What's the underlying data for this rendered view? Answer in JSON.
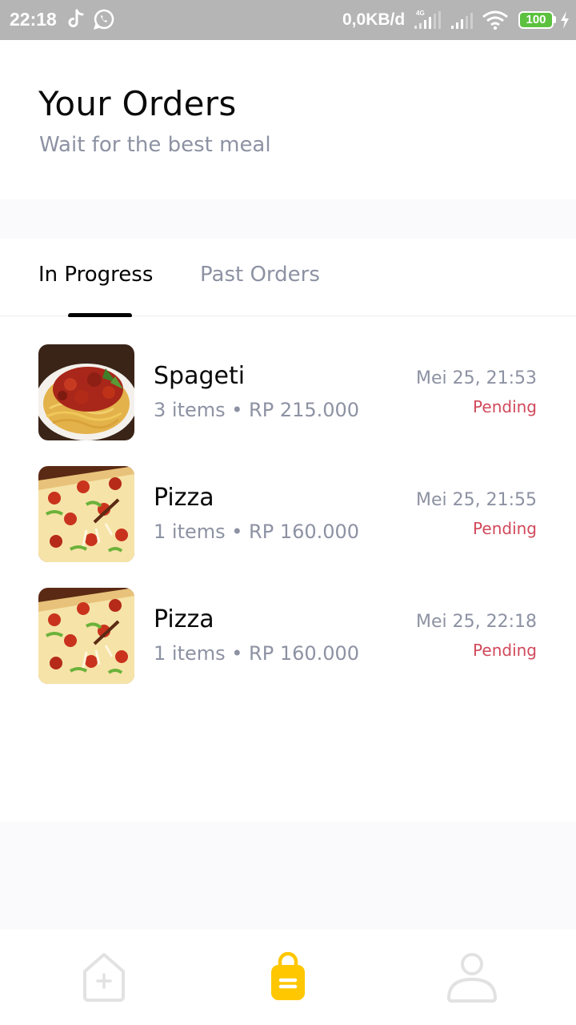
{
  "status_bar": {
    "time": "22:18",
    "network_speed": "0,0KB/d",
    "network_type": "4G",
    "battery": "100",
    "icons": [
      "tiktok-icon",
      "whatsapp-icon",
      "signal-icon",
      "wifi-icon",
      "battery-icon",
      "charging-icon"
    ]
  },
  "header": {
    "title": "Your Orders",
    "subtitle": "Wait for the best meal"
  },
  "tabs": [
    {
      "label": "In Progress",
      "active": true
    },
    {
      "label": "Past Orders",
      "active": false
    }
  ],
  "orders": [
    {
      "name": "Spageti",
      "quantity": "3 items",
      "price": "RP 215.000",
      "date": "Mei 25, 21:53",
      "status": "Pending",
      "image": "spaghetti-image"
    },
    {
      "name": "Pizza",
      "quantity": "1 items",
      "price": "RP 160.000",
      "date": "Mei 25, 21:55",
      "status": "Pending",
      "image": "pizza-image"
    },
    {
      "name": "Pizza",
      "quantity": "1 items",
      "price": "RP 160.000",
      "date": "Mei 25, 22:18",
      "status": "Pending",
      "image": "pizza-image"
    }
  ],
  "bottom_nav": [
    {
      "name": "home",
      "icon": "home-plus-icon",
      "active": false
    },
    {
      "name": "orders",
      "icon": "shopping-bag-icon",
      "active": true
    },
    {
      "name": "profile",
      "icon": "user-icon",
      "active": false
    }
  ],
  "colors": {
    "accent": "#FFC700",
    "status_pending": "#D1495B",
    "text_primary": "#020202",
    "text_secondary": "#8D92A3",
    "background_band": "#FAFAFC",
    "status_bar": "#B5B5B5",
    "battery": "#5CC13F"
  }
}
